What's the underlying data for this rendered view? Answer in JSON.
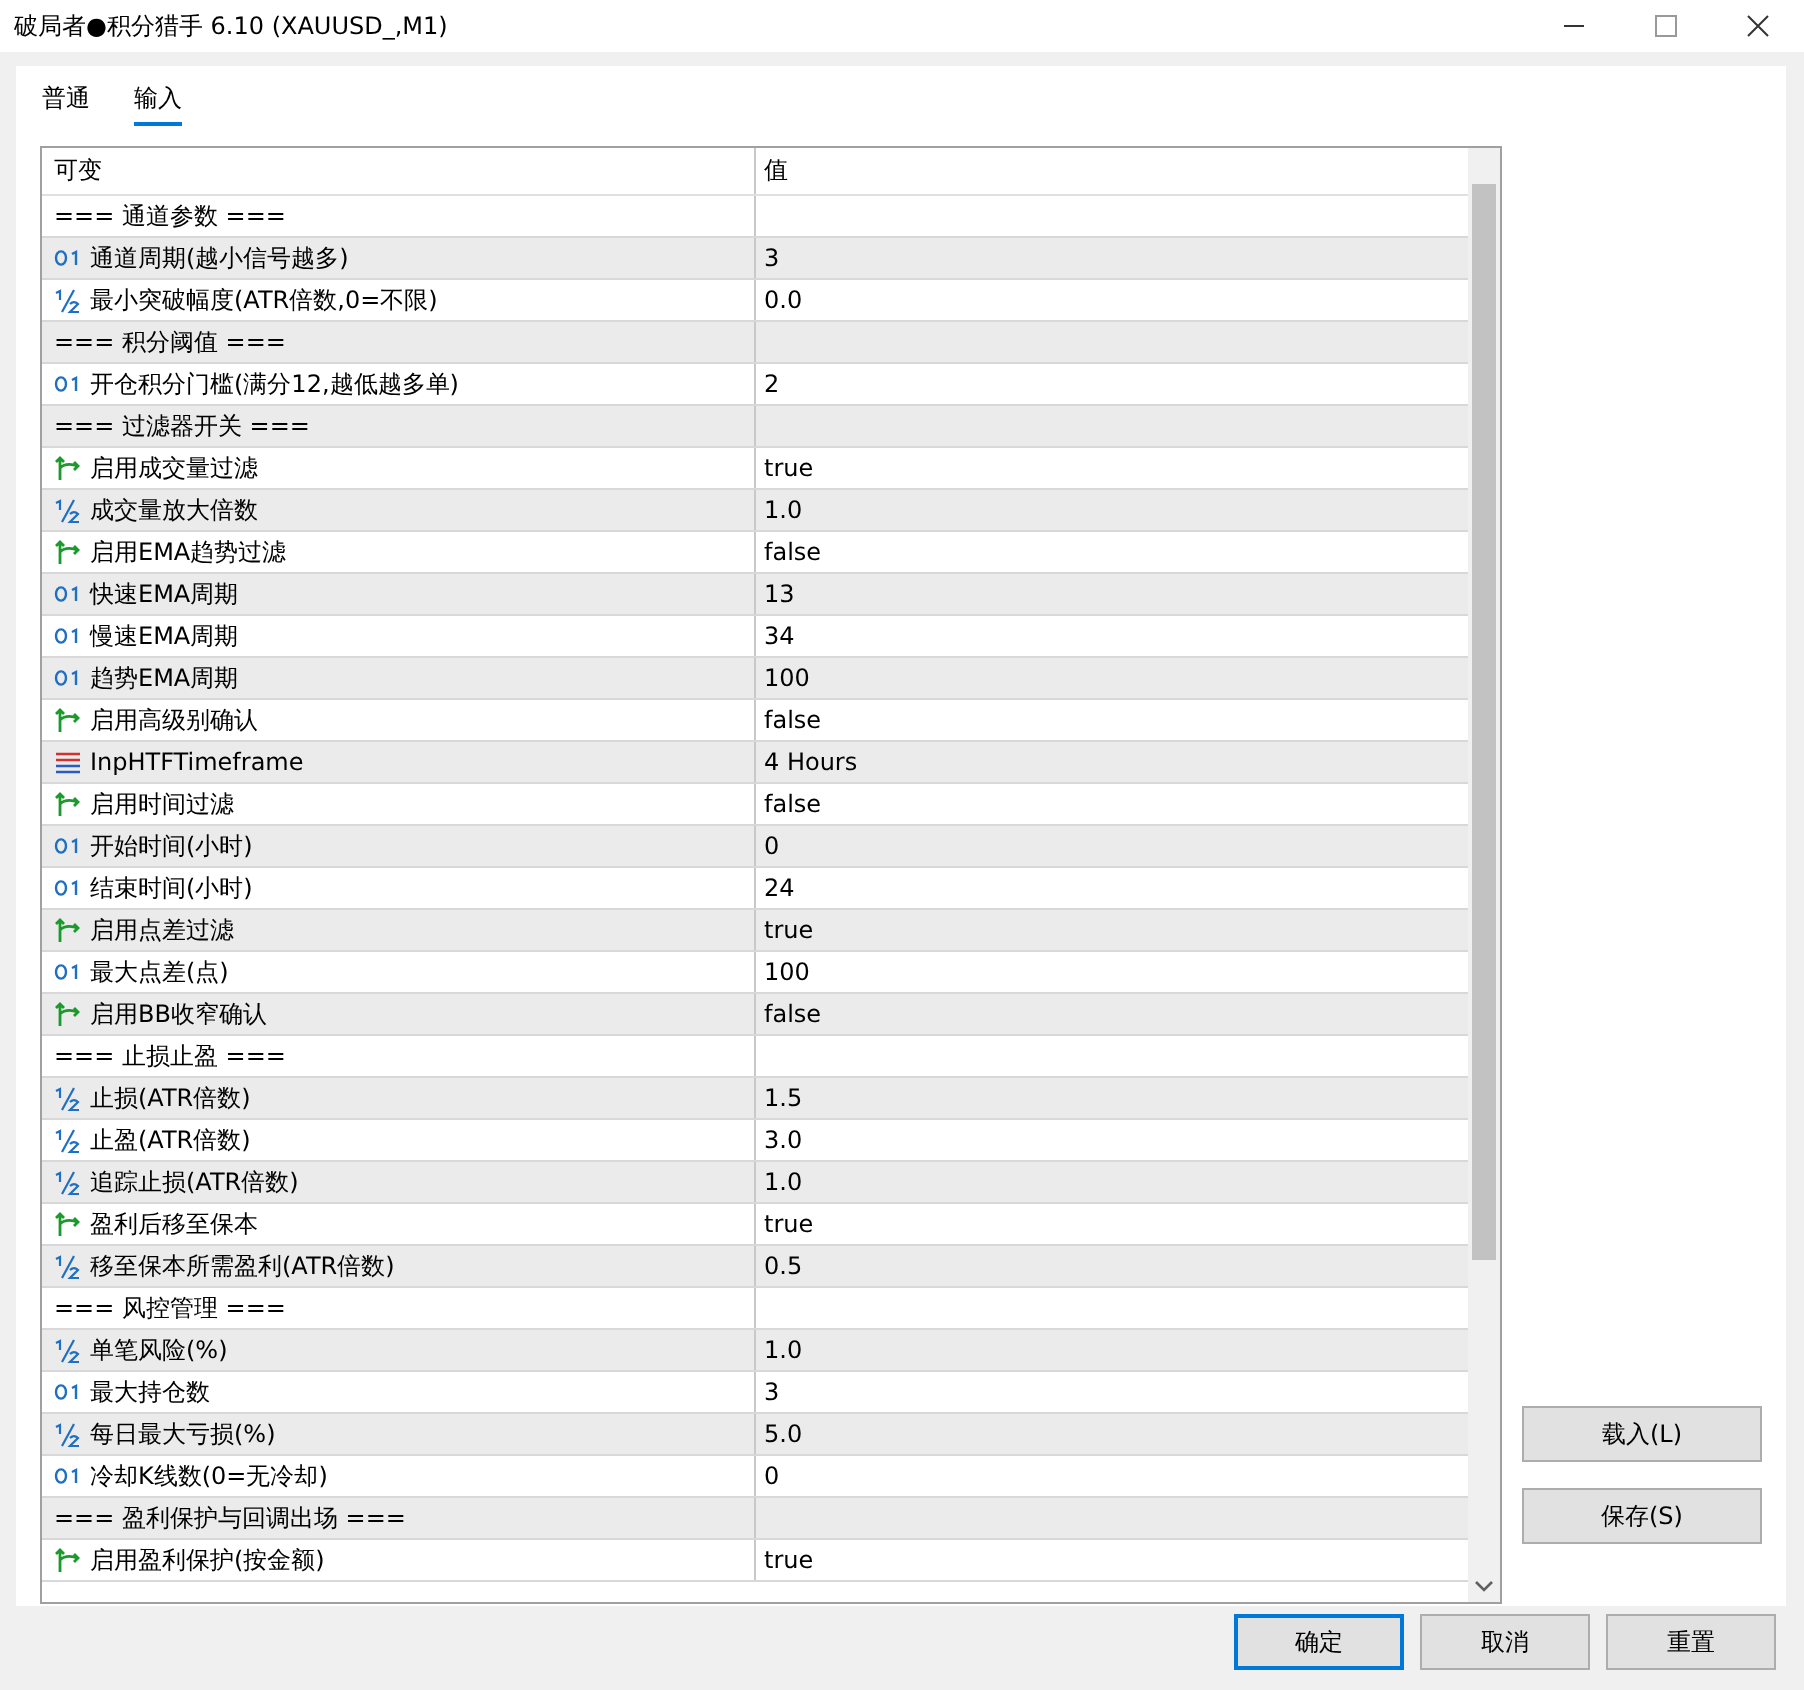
{
  "window": {
    "title": "破局者●积分猎手 6.10 (XAUUSD_,M1)"
  },
  "tabs": [
    {
      "label": "普通",
      "selected": false
    },
    {
      "label": "输入",
      "selected": true
    }
  ],
  "table": {
    "columns": [
      "可变",
      "值"
    ],
    "rows": [
      {
        "kind": "section",
        "name": "=== 通道参数 ==="
      },
      {
        "kind": "int",
        "name": "通道周期(越小信号越多)",
        "value": "3"
      },
      {
        "kind": "double",
        "name": "最小突破幅度(ATR倍数,0=不限)",
        "value": "0.0"
      },
      {
        "kind": "section",
        "name": "=== 积分阈值 ==="
      },
      {
        "kind": "int",
        "name": "开仓积分门槛(满分12,越低越多单)",
        "value": "2"
      },
      {
        "kind": "section",
        "name": "=== 过滤器开关 ==="
      },
      {
        "kind": "bool",
        "name": "启用成交量过滤",
        "value": "true"
      },
      {
        "kind": "double",
        "name": "成交量放大倍数",
        "value": "1.0"
      },
      {
        "kind": "bool",
        "name": "启用EMA趋势过滤",
        "value": "false"
      },
      {
        "kind": "int",
        "name": "快速EMA周期",
        "value": "13"
      },
      {
        "kind": "int",
        "name": "慢速EMA周期",
        "value": "34"
      },
      {
        "kind": "int",
        "name": "趋势EMA周期",
        "value": "100"
      },
      {
        "kind": "bool",
        "name": "启用高级别确认",
        "value": "false"
      },
      {
        "kind": "enum",
        "name": "InpHTFTimeframe",
        "value": "4 Hours"
      },
      {
        "kind": "bool",
        "name": "启用时间过滤",
        "value": "false"
      },
      {
        "kind": "int",
        "name": "开始时间(小时)",
        "value": "0"
      },
      {
        "kind": "int",
        "name": "结束时间(小时)",
        "value": "24"
      },
      {
        "kind": "bool",
        "name": "启用点差过滤",
        "value": "true"
      },
      {
        "kind": "int",
        "name": "最大点差(点)",
        "value": "100"
      },
      {
        "kind": "bool",
        "name": "启用BB收窄确认",
        "value": "false"
      },
      {
        "kind": "section",
        "name": "=== 止损止盈 ==="
      },
      {
        "kind": "double",
        "name": "止损(ATR倍数)",
        "value": "1.5"
      },
      {
        "kind": "double",
        "name": "止盈(ATR倍数)",
        "value": "3.0"
      },
      {
        "kind": "double",
        "name": "追踪止损(ATR倍数)",
        "value": "1.0"
      },
      {
        "kind": "bool",
        "name": "盈利后移至保本",
        "value": "true"
      },
      {
        "kind": "double",
        "name": "移至保本所需盈利(ATR倍数)",
        "value": "0.5"
      },
      {
        "kind": "section",
        "name": "=== 风控管理 ==="
      },
      {
        "kind": "double",
        "name": "单笔风险(%)",
        "value": "1.0"
      },
      {
        "kind": "int",
        "name": "最大持仓数",
        "value": "3"
      },
      {
        "kind": "double",
        "name": "每日最大亏损(%)",
        "value": "5.0"
      },
      {
        "kind": "int",
        "name": "冷却K线数(0=无冷却)",
        "value": "0"
      },
      {
        "kind": "section",
        "name": "=== 盈利保护与回调出场 ==="
      },
      {
        "kind": "bool",
        "name": "启用盈利保护(按金额)",
        "value": "true"
      }
    ]
  },
  "side_buttons": [
    "载入(L)",
    "保存(S)"
  ],
  "footer_buttons": [
    {
      "label": "确定",
      "selected": true
    },
    {
      "label": "取消",
      "selected": false
    },
    {
      "label": "重置",
      "selected": false
    }
  ]
}
